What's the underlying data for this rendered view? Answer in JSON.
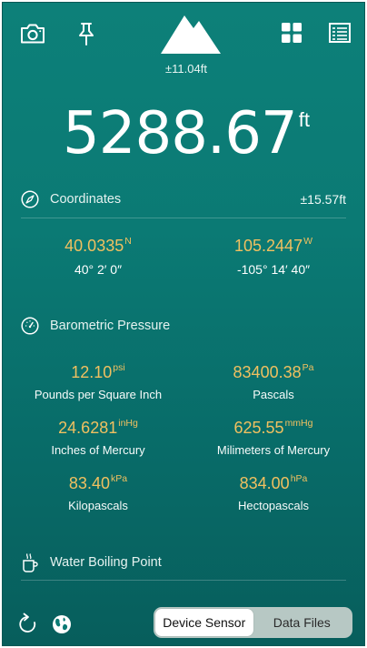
{
  "header": {
    "accuracy": "±11.04ft"
  },
  "altitude": {
    "value": "5288.67",
    "unit": "ft"
  },
  "coordinates": {
    "title": "Coordinates",
    "accuracy": "±15.57ft",
    "latitude": {
      "decimal": "40.0335",
      "hemisphere": "N",
      "dms": "40° 2′ 0″"
    },
    "longitude": {
      "decimal": "105.2447",
      "hemisphere": "W",
      "dms": "-105° 14′ 40″"
    }
  },
  "pressure": {
    "title": "Barometric Pressure",
    "items": [
      {
        "value": "12.10",
        "unit": "psi",
        "label": "Pounds per Square Inch"
      },
      {
        "value": "83400.38",
        "unit": "Pa",
        "label": "Pascals"
      },
      {
        "value": "24.6281",
        "unit": "inHg",
        "label": "Inches of Mercury"
      },
      {
        "value": "625.55",
        "unit": "mmHg",
        "label": "Milimeters of Mercury"
      },
      {
        "value": "83.40",
        "unit": "kPa",
        "label": "Kilopascals"
      },
      {
        "value": "834.00",
        "unit": "hPa",
        "label": "Hectopascals"
      }
    ]
  },
  "boiling": {
    "title": "Water Boiling Point"
  },
  "footer": {
    "segments": [
      "Device Sensor",
      "Data Files"
    ],
    "selected": "Device Sensor"
  }
}
